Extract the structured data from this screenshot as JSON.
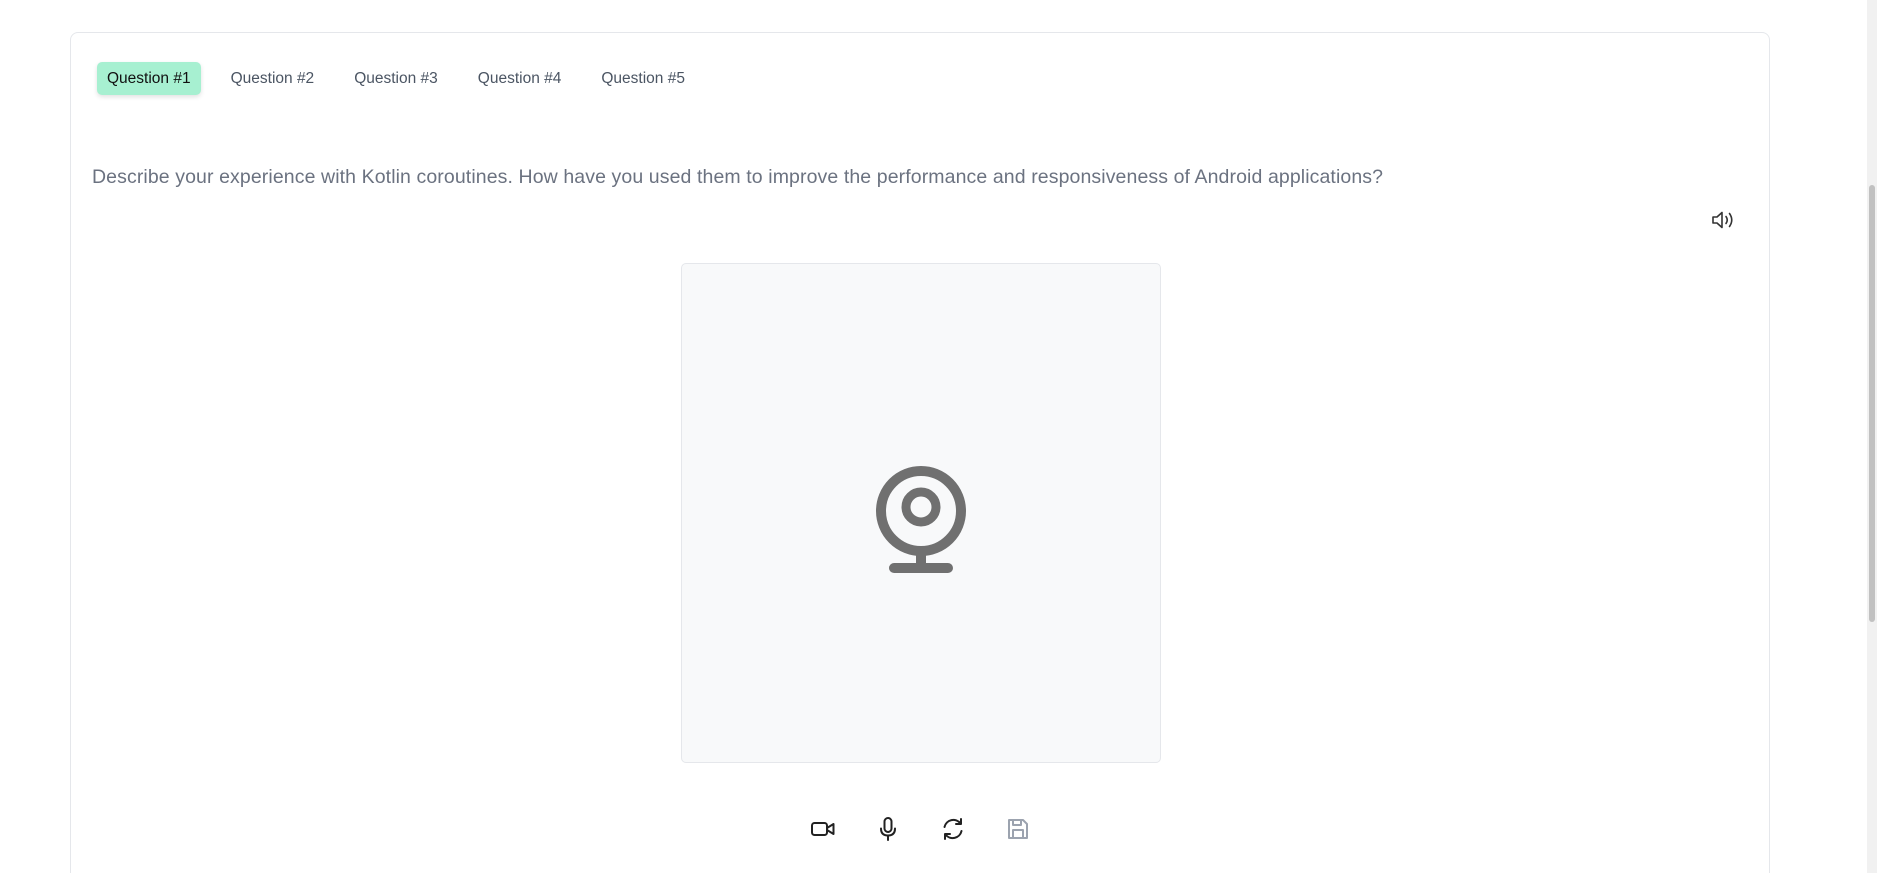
{
  "tabs": [
    {
      "label": "Question #1",
      "active": true
    },
    {
      "label": "Question #2",
      "active": false
    },
    {
      "label": "Question #3",
      "active": false
    },
    {
      "label": "Question #4",
      "active": false
    },
    {
      "label": "Question #5",
      "active": false
    }
  ],
  "question": {
    "text": "Describe your experience with Kotlin coroutines. How have you used them to improve the performance and responsiveness of Android applications?"
  },
  "icons": {
    "speaker": "speaker-icon",
    "preview": "webcam-icon",
    "controls": [
      "video-camera-icon",
      "microphone-icon",
      "refresh-icon",
      "save-icon"
    ]
  },
  "colors": {
    "active_tab_bg": "#a7f0d1",
    "question_text": "#6b7280",
    "icon_dark": "#222222",
    "icon_muted": "#9ca3af",
    "webcam_icon": "#707070"
  }
}
